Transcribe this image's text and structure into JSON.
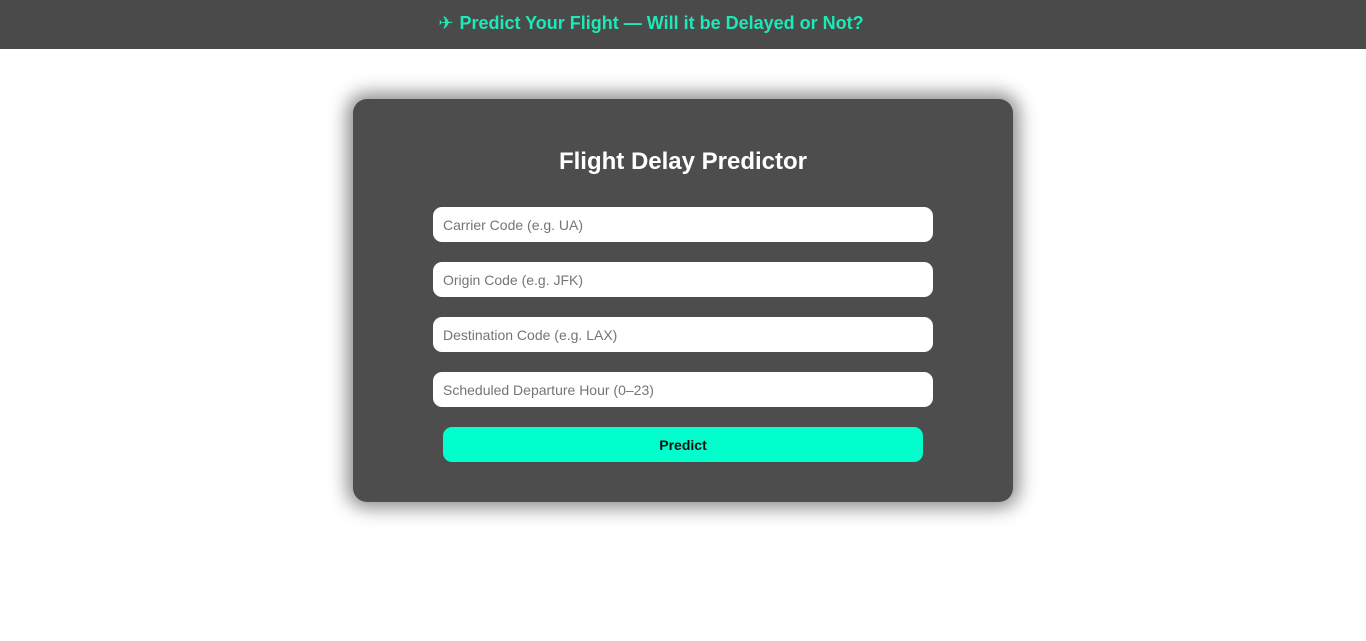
{
  "header": {
    "plane_icon": "✈",
    "title": "Predict Your Flight — Will it be Delayed or Not?"
  },
  "form": {
    "title": "Flight Delay Predictor",
    "fields": [
      {
        "placeholder": "Carrier Code (e.g. UA)",
        "value": ""
      },
      {
        "placeholder": "Origin Code (e.g. JFK)",
        "value": ""
      },
      {
        "placeholder": "Destination Code (e.g. LAX)",
        "value": ""
      },
      {
        "placeholder": "Scheduled Departure Hour (0–23)",
        "value": ""
      }
    ],
    "submit_label": "Predict"
  },
  "colors": {
    "banner_bg": "#4a4a4a",
    "accent": "#1de9b6",
    "card_bg": "#4d4d4d",
    "button_bg": "#00ffcc"
  }
}
